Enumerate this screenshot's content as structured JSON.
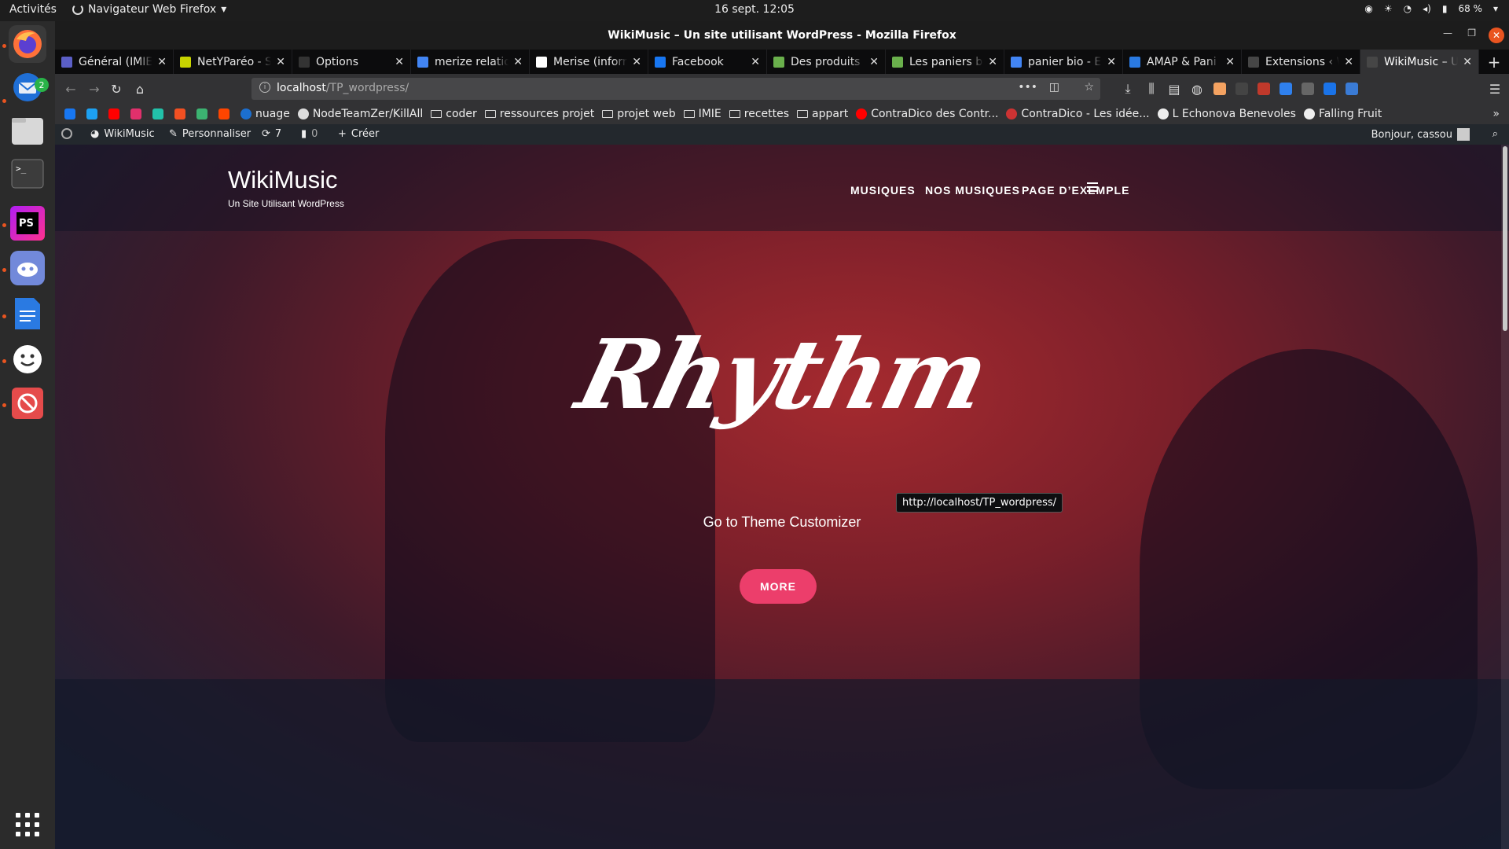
{
  "system": {
    "activities": "Activités",
    "app_menu": "Navigateur Web Firefox",
    "clock": "16 sept.  12:05",
    "battery": "68 %"
  },
  "dock": {
    "thunderbird_badge": "2"
  },
  "window": {
    "title": "WikiMusic – Un site utilisant WordPress - Mozilla Firefox"
  },
  "tabs": [
    {
      "label": "Général (IMIE",
      "color": "#5b5fc7"
    },
    {
      "label": "NetYParéo - S",
      "color": "#c8d400"
    },
    {
      "label": "Options",
      "color": "#333333"
    },
    {
      "label": "merize relatio",
      "color": "#4285f4"
    },
    {
      "label": "Merise (inforn",
      "color": "#ffffff"
    },
    {
      "label": "Facebook",
      "color": "#1877f2"
    },
    {
      "label": "Des produits",
      "color": "#6ab04c"
    },
    {
      "label": "Les paniers b",
      "color": "#6ab04c"
    },
    {
      "label": "panier bio - E",
      "color": "#4285f4"
    },
    {
      "label": "AMAP & Pani",
      "color": "#2a7ae2"
    },
    {
      "label": "Extensions ‹ Wik",
      "color": "#464646"
    },
    {
      "label": "WikiMusic – Un s",
      "color": "#464646"
    }
  ],
  "urlbar": {
    "host": "localhost",
    "path": "/TP_wordpress/"
  },
  "bookmarks": [
    {
      "type": "icon",
      "color": "#1877f2",
      "name": "facebook-bookmark"
    },
    {
      "type": "icon",
      "color": "#1da1f2",
      "name": "twitter-bookmark"
    },
    {
      "type": "icon",
      "color": "#ff0000",
      "name": "youtube-bookmark"
    },
    {
      "type": "icon",
      "color": "#e1306c",
      "name": "instagram-bookmark"
    },
    {
      "type": "icon",
      "color": "#22c1a9",
      "name": "mastodon-bookmark"
    },
    {
      "type": "icon",
      "color": "#f25022",
      "name": "microsoft-bookmark"
    },
    {
      "type": "icon",
      "color": "#3cb371",
      "name": "feedly-bookmark"
    },
    {
      "type": "icon",
      "color": "#ff4500",
      "name": "reddit-bookmark"
    },
    {
      "type": "link",
      "label": "nuage",
      "color": "#1c6fd0"
    },
    {
      "type": "link",
      "label": "NodeTeamZer/KillAll",
      "color": "#dddddd"
    },
    {
      "type": "folder",
      "label": "coder"
    },
    {
      "type": "folder",
      "label": "ressources projet"
    },
    {
      "type": "folder",
      "label": "projet web"
    },
    {
      "type": "folder",
      "label": "IMIE"
    },
    {
      "type": "folder",
      "label": "recettes"
    },
    {
      "type": "folder",
      "label": "appart"
    },
    {
      "type": "link",
      "label": "ContraDico des Contr...",
      "color": "#ff0000"
    },
    {
      "type": "link",
      "label": "ContraDico - Les idée...",
      "color": "#cc3333"
    },
    {
      "type": "link",
      "label": "L Echonova Benevoles",
      "color": "#eeeeee"
    },
    {
      "type": "link",
      "label": "Falling Fruit",
      "color": "#eeeeee"
    }
  ],
  "adminbar": {
    "site": "WikiMusic",
    "customize": "Personnaliser",
    "updates": "7",
    "comments": "0",
    "new": "Créer",
    "greeting": "Bonjour, cassou"
  },
  "site": {
    "title": "WikiMusic",
    "tagline": "Un Site Utilisant WordPress",
    "menu": [
      "MUSIQUES",
      "NOS MUSIQUES",
      "PAGE D’EXEMPLE"
    ],
    "hero_title": "Rhythm",
    "hero_subtitle": "Go to Theme Customizer",
    "more_button": "MORE",
    "tooltip": "http://localhost/TP_wordpress/"
  },
  "colors": {
    "accent": "#ec3e6b",
    "ubuntu_orange": "#e95420"
  }
}
